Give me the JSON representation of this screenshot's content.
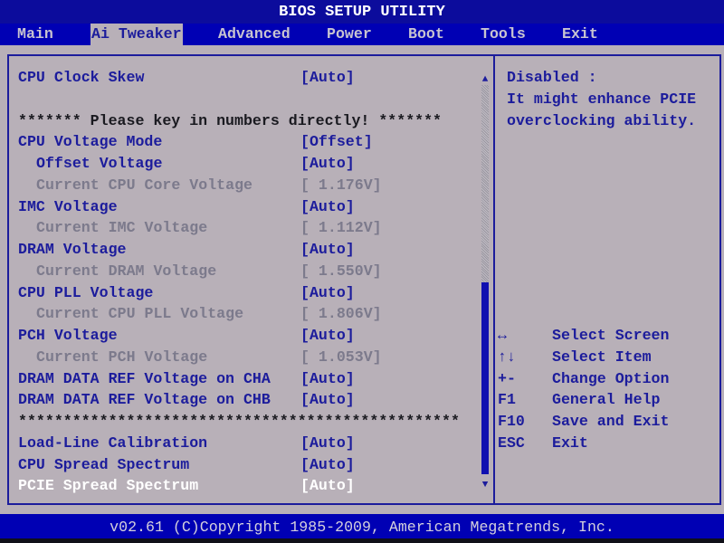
{
  "title": "BIOS SETUP UTILITY",
  "menu": [
    {
      "label": "Main",
      "active": false
    },
    {
      "label": "Ai Tweaker",
      "active": true
    },
    {
      "label": "Advanced",
      "active": false
    },
    {
      "label": "Power",
      "active": false
    },
    {
      "label": "Boot",
      "active": false
    },
    {
      "label": "Tools",
      "active": false
    },
    {
      "label": "Exit",
      "active": false
    }
  ],
  "rows": [
    {
      "label": "CPU Clock Skew",
      "value": "[Auto]",
      "style": "blue",
      "indent": false
    },
    {
      "label": "",
      "value": "",
      "style": "blue",
      "indent": false
    },
    {
      "label": "******* Please key in numbers directly! *******",
      "value": "",
      "style": "black",
      "indent": false
    },
    {
      "label": "CPU Voltage Mode",
      "value": "[Offset]",
      "style": "blue",
      "indent": false
    },
    {
      "label": "Offset Voltage",
      "value": "[Auto]",
      "style": "blue",
      "indent": true
    },
    {
      "label": "Current CPU Core Voltage",
      "value": "[ 1.176V]",
      "style": "gray",
      "indent": true
    },
    {
      "label": "IMC Voltage",
      "value": "[Auto]",
      "style": "blue",
      "indent": false
    },
    {
      "label": "Current IMC Voltage",
      "value": "[ 1.112V]",
      "style": "gray",
      "indent": true
    },
    {
      "label": "DRAM Voltage",
      "value": "[Auto]",
      "style": "blue",
      "indent": false
    },
    {
      "label": "Current DRAM Voltage",
      "value": "[ 1.550V]",
      "style": "gray",
      "indent": true
    },
    {
      "label": "CPU PLL Voltage",
      "value": "[Auto]",
      "style": "blue",
      "indent": false
    },
    {
      "label": "Current CPU PLL Voltage",
      "value": "[ 1.806V]",
      "style": "gray",
      "indent": true
    },
    {
      "label": "PCH Voltage",
      "value": "[Auto]",
      "style": "blue",
      "indent": false
    },
    {
      "label": "Current PCH Voltage",
      "value": "[ 1.053V]",
      "style": "gray",
      "indent": true
    },
    {
      "label": "DRAM DATA REF Voltage on CHA",
      "value": "[Auto]",
      "style": "blue",
      "indent": false
    },
    {
      "label": "DRAM DATA REF Voltage on CHB",
      "value": "[Auto]",
      "style": "blue",
      "indent": false
    },
    {
      "label": "*************************************************",
      "value": "",
      "style": "black",
      "indent": false
    },
    {
      "label": "Load-Line Calibration",
      "value": "[Auto]",
      "style": "blue",
      "indent": false
    },
    {
      "label": "CPU Spread Spectrum",
      "value": "[Auto]",
      "style": "blue",
      "indent": false
    },
    {
      "label": "PCIE Spread Spectrum",
      "value": "[Auto]",
      "style": "white",
      "indent": false,
      "selected": true
    }
  ],
  "scrollbar": {
    "up_icon": "triangle-up",
    "down_icon": "triangle-down",
    "up_glyph": "▲",
    "down_glyph": "▼",
    "position_percent": 100
  },
  "help": {
    "text": "Disabled :\nIt might enhance PCIE\noverclocking ability."
  },
  "keys": [
    {
      "key": "↔",
      "desc": "Select Screen"
    },
    {
      "key": "↑↓",
      "desc": "Select Item"
    },
    {
      "key": "+-",
      "desc": "Change Option"
    },
    {
      "key": "F1",
      "desc": "General Help"
    },
    {
      "key": "F10",
      "desc": "Save and Exit"
    },
    {
      "key": "ESC",
      "desc": "Exit"
    }
  ],
  "footer": "v02.61 (C)Copyright 1985-2009, American Megatrends, Inc.",
  "colors": {
    "background": "#b8b0b8",
    "bar_blue": "#0000b4",
    "text_blue": "#1c1c9c",
    "disabled_gray": "#7c7a8c",
    "selected": "#ffffff"
  }
}
